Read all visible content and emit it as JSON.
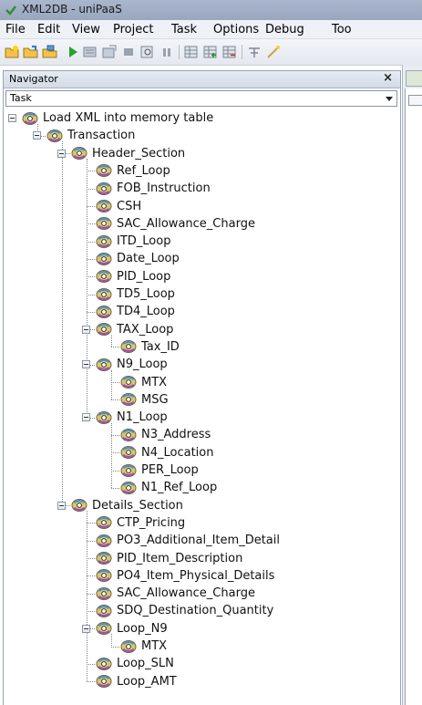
{
  "window": {
    "title": "XML2DB - uniPaaS"
  },
  "menu": [
    "File",
    "Edit",
    "View",
    "Project",
    "Task",
    "Options",
    "Debug",
    "Too"
  ],
  "navigator": {
    "title": "Navigator",
    "close": "×",
    "mode": "Task"
  },
  "tree": [
    {
      "label": "Load XML into memory table",
      "level": 0,
      "expanded": true
    },
    {
      "label": "Transaction",
      "level": 1,
      "expanded": true
    },
    {
      "label": "Header_Section",
      "level": 2,
      "expanded": true
    },
    {
      "label": "Ref_Loop",
      "level": 3
    },
    {
      "label": "FOB_Instruction",
      "level": 3
    },
    {
      "label": "CSH",
      "level": 3
    },
    {
      "label": "SAC_Allowance_Charge",
      "level": 3
    },
    {
      "label": "ITD_Loop",
      "level": 3
    },
    {
      "label": "Date_Loop",
      "level": 3
    },
    {
      "label": "PID_Loop",
      "level": 3
    },
    {
      "label": "TD5_Loop",
      "level": 3
    },
    {
      "label": "TD4_Loop",
      "level": 3
    },
    {
      "label": "TAX_Loop",
      "level": 3,
      "expanded": true
    },
    {
      "label": "Tax_ID",
      "level": 4
    },
    {
      "label": "N9_Loop",
      "level": 3,
      "expanded": true
    },
    {
      "label": "MTX",
      "level": 4
    },
    {
      "label": "MSG",
      "level": 4
    },
    {
      "label": "N1_Loop",
      "level": 3,
      "expanded": true
    },
    {
      "label": "N3_Address",
      "level": 4
    },
    {
      "label": "N4_Location",
      "level": 4
    },
    {
      "label": "PER_Loop",
      "level": 4
    },
    {
      "label": "N1_Ref_Loop",
      "level": 4
    },
    {
      "label": "Details_Section",
      "level": 2,
      "expanded": true
    },
    {
      "label": "CTP_Pricing",
      "level": 3
    },
    {
      "label": "PO3_Additional_Item_Detail",
      "level": 3
    },
    {
      "label": "PID_Item_Description",
      "level": 3
    },
    {
      "label": "PO4_Item_Physical_Details",
      "level": 3
    },
    {
      "label": "SAC_Allowance_Charge",
      "level": 3
    },
    {
      "label": "SDQ_Destination_Quantity",
      "level": 3
    },
    {
      "label": "Loop_N9",
      "level": 3,
      "expanded": true
    },
    {
      "label": "MTX",
      "level": 4
    },
    {
      "label": "Loop_SLN",
      "level": 3
    },
    {
      "label": "Loop_AMT",
      "level": 3
    }
  ],
  "toolbar_icons": [
    "new-icon",
    "open-icon",
    "open-project-icon",
    "run-icon",
    "step-into-icon",
    "step-over-icon",
    "stop-icon",
    "find-icon",
    "pause-icon",
    "grid-icon",
    "grid-add-icon",
    "grid-delete-icon",
    "expand-icon",
    "wand-icon"
  ]
}
